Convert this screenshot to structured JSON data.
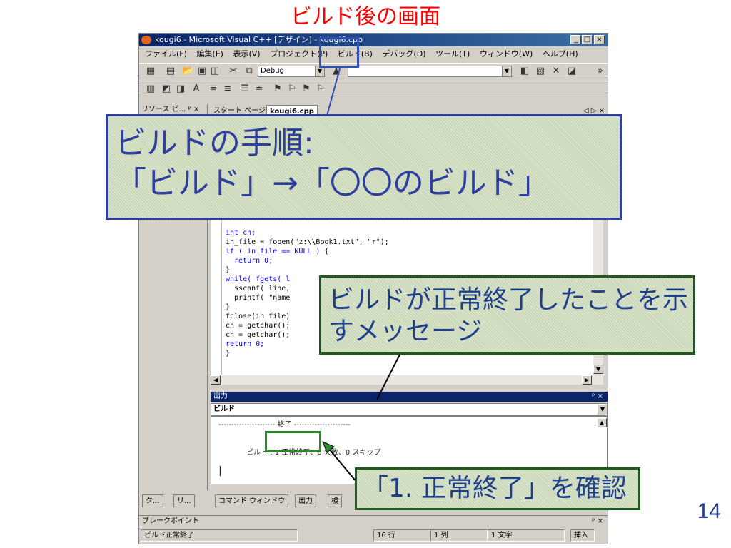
{
  "slide": {
    "title": "ビルド後の画面",
    "page_number": "14"
  },
  "window": {
    "title": "kougi6 - Microsoft Visual C++ [デザイン] - kougi6.cpp",
    "controls": [
      "_",
      "□",
      "×"
    ]
  },
  "menu": [
    "ファイル(F)",
    "編集(E)",
    "表示(V)",
    "プロジェクト(P)",
    "ビルド(B)",
    "デバッグ(D)",
    "ツール(T)",
    "ウィンドウ(W)",
    "ヘルプ(H)"
  ],
  "toolbar": {
    "config_value": "Debug",
    "overflow": "»"
  },
  "left_pane": {
    "title": "リソース ビ...",
    "pin": "ᵖ",
    "close": "×"
  },
  "tabs": {
    "start_page": "スタート ページ",
    "active": "kougi6.cpp",
    "nav": "◁ ▷ ×"
  },
  "code_lines": [
    {
      "text": "int ch;",
      "kw": true
    },
    {
      "text": "in_file = fopen(\"z:\\\\Book1.txt\", \"r\");",
      "kw": false
    },
    {
      "text": "if ( in_file == NULL ) {",
      "kw": true
    },
    {
      "text": "  return 0;",
      "kw": true
    },
    {
      "text": "}",
      "kw": false
    },
    {
      "text": "while( fgets( l",
      "kw": true
    },
    {
      "text": "  sscanf( line,",
      "kw": false
    },
    {
      "text": "  printf( \"name",
      "kw": false
    },
    {
      "text": "}",
      "kw": false
    },
    {
      "text": "fclose(in_file)",
      "kw": false
    },
    {
      "text": "ch = getchar();",
      "kw": false
    },
    {
      "text": "ch = getchar();",
      "kw": false
    },
    {
      "text": "return 0;",
      "kw": true
    },
    {
      "text": "}",
      "kw": false
    }
  ],
  "output": {
    "title": "出力",
    "pin_close": "ᵖ ×",
    "source": "ビルド",
    "line1": "---------------------- 終了 ----------------------",
    "line2_prefix": "ビルド : ",
    "line2_success": "1 正常終了",
    "line2_rest": "、0 失敗、0 スキップ",
    "cursor": "|"
  },
  "bottom_tabs": [
    "ク...",
    "リ...",
    "コマンド ウィンドウ",
    "出力",
    "検"
  ],
  "breakpoints": {
    "label": "ブレークポイント",
    "controls": "ᵖ ×"
  },
  "status": {
    "message": "ビルド正常終了",
    "line": "16 行",
    "col": "1 列",
    "chars": "1 文字",
    "mode": "挿入"
  },
  "callouts": {
    "main_line1": "ビルドの手順:",
    "main_line2": "「ビルド」→「〇〇のビルド」",
    "msg_line1": "ビルドが正常終了したことを示",
    "msg_line2": "すメッセージ",
    "check": "「1. 正常終了」を確認"
  },
  "colors": {
    "accent_red": "#ff0000",
    "callout_blue": "#2e3f9e",
    "callout_green": "#1e5a1e",
    "highlight_green": "#2a8a2a"
  }
}
